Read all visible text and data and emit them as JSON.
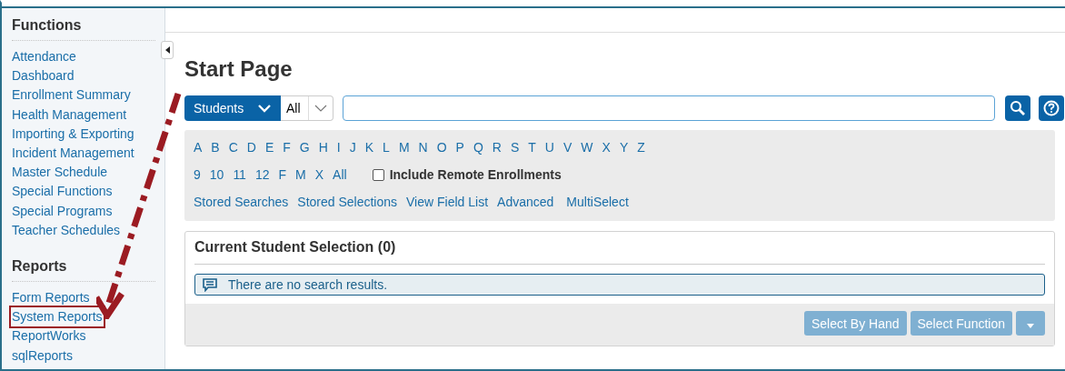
{
  "sidebar": {
    "sections": [
      {
        "title": "Functions",
        "items": [
          {
            "label": "Attendance",
            "highlighted": false
          },
          {
            "label": "Dashboard",
            "highlighted": false
          },
          {
            "label": "Enrollment Summary",
            "highlighted": false
          },
          {
            "label": "Health Management",
            "highlighted": false
          },
          {
            "label": "Importing & Exporting",
            "highlighted": false
          },
          {
            "label": "Incident Management",
            "highlighted": false
          },
          {
            "label": "Master Schedule",
            "highlighted": false
          },
          {
            "label": "Special Functions",
            "highlighted": false
          },
          {
            "label": "Special Programs",
            "highlighted": false
          },
          {
            "label": "Teacher Schedules",
            "highlighted": false
          }
        ]
      },
      {
        "title": "Reports",
        "items": [
          {
            "label": "Form Reports",
            "highlighted": false
          },
          {
            "label": "System Reports",
            "highlighted": true
          },
          {
            "label": "ReportWorks",
            "highlighted": false
          },
          {
            "label": "sqlReports",
            "highlighted": false
          }
        ]
      }
    ]
  },
  "page_title": "Start Page",
  "search": {
    "scope": "Students",
    "filter": "All"
  },
  "letters": [
    "A",
    "B",
    "C",
    "D",
    "E",
    "F",
    "G",
    "H",
    "I",
    "J",
    "K",
    "L",
    "M",
    "N",
    "O",
    "P",
    "Q",
    "R",
    "S",
    "T",
    "U",
    "V",
    "W",
    "X",
    "Y",
    "Z"
  ],
  "grades": [
    "9",
    "10",
    "11",
    "12",
    "F",
    "M",
    "X",
    "All"
  ],
  "include_remote": {
    "label": "Include Remote Enrollments",
    "checked": false
  },
  "links": [
    "Stored Searches",
    "Stored Selections",
    "View Field List",
    "Advanced",
    "MultiSelect"
  ],
  "selection": {
    "title": "Current Student Selection (0)",
    "message": "There are no search results."
  },
  "buttons": [
    {
      "label": "Select By Hand",
      "disabled": true
    },
    {
      "label": "Select Function",
      "disabled": true
    }
  ],
  "annotation_arrow": true
}
